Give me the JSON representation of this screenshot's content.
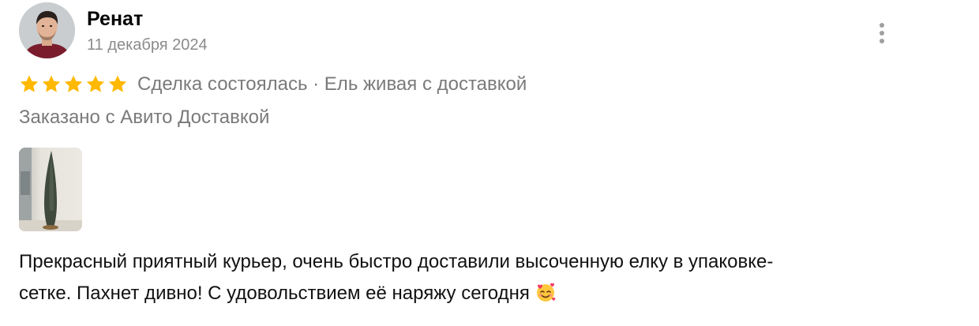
{
  "review": {
    "author": {
      "name": "Ренат",
      "avatar_icon": "user-photo"
    },
    "date": "11 декабря 2024",
    "menu_icon": "more-vertical-icon",
    "rating": {
      "value": 5,
      "max": 5,
      "star_color": "#ffb800",
      "deal_text": "Сделка состоялась · Ель живая с доставкой"
    },
    "delivery_note": "Заказано с Авито Доставкой",
    "photos": [
      {
        "icon": "photo-thumbnail"
      }
    ],
    "text_line1": "Прекрасный приятный курьер, очень быстро доставили высоченную елку в упаковке-",
    "text_line2": "сетке. Пахнет дивно! С удовольствием её наряжу сегодня",
    "emoji": "smiling-face-with-hearts-emoji"
  },
  "colors": {
    "secondary_text": "#7a7a7a",
    "date_text": "#8b8b8b",
    "body_text": "#111111"
  }
}
